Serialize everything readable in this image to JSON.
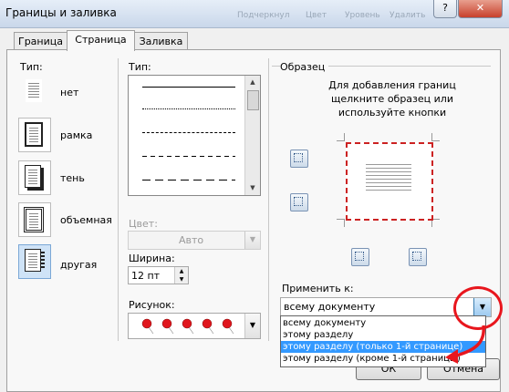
{
  "window": {
    "title": "Границы и заливка",
    "help_label": "?",
    "close_label": "✕",
    "ghost_ribbon": [
      "Подчеркнул",
      "Цвет",
      "Уровень",
      "Удалить"
    ]
  },
  "tabs": [
    {
      "label": "Граница",
      "active": false
    },
    {
      "label": "Страница",
      "active": true
    },
    {
      "label": "Заливка",
      "active": false
    }
  ],
  "settings": {
    "label": "Тип:",
    "items": [
      {
        "label": "нет",
        "icon": "no-border-icon"
      },
      {
        "label": "рамка",
        "icon": "box-border-icon"
      },
      {
        "label": "тень",
        "icon": "shadow-border-icon"
      },
      {
        "label": "объемная",
        "icon": "3d-border-icon"
      },
      {
        "label": "другая",
        "icon": "custom-border-icon",
        "selected": true
      }
    ]
  },
  "style": {
    "label": "Тип:",
    "lines": [
      "solid",
      "dotted",
      "dashed-fine",
      "dashed",
      "dash-long",
      "dash-dot"
    ]
  },
  "color": {
    "label": "Цвет:",
    "value": "Авто",
    "disabled": true
  },
  "width": {
    "label": "Ширина:",
    "value": "12 пт"
  },
  "art": {
    "label": "Рисунок:",
    "value": "red-pins-pattern"
  },
  "preview": {
    "label": "Образец",
    "hint": [
      "Для добавления границ",
      "щелкните образец или",
      "используйте кнопки"
    ]
  },
  "apply_to": {
    "label": "Применить к:",
    "value": "всему документу",
    "options": [
      "всему документу",
      "этому разделу",
      "этому разделу (только 1-й странице)",
      "этому разделу (кроме 1-й страницы)"
    ],
    "highlighted_index": 2
  },
  "buttons": {
    "ok": "ОК",
    "cancel": "Отмена"
  },
  "colors": {
    "annotation": "#e8161d",
    "selection": "#3399ff",
    "pin": "#e0161d"
  }
}
